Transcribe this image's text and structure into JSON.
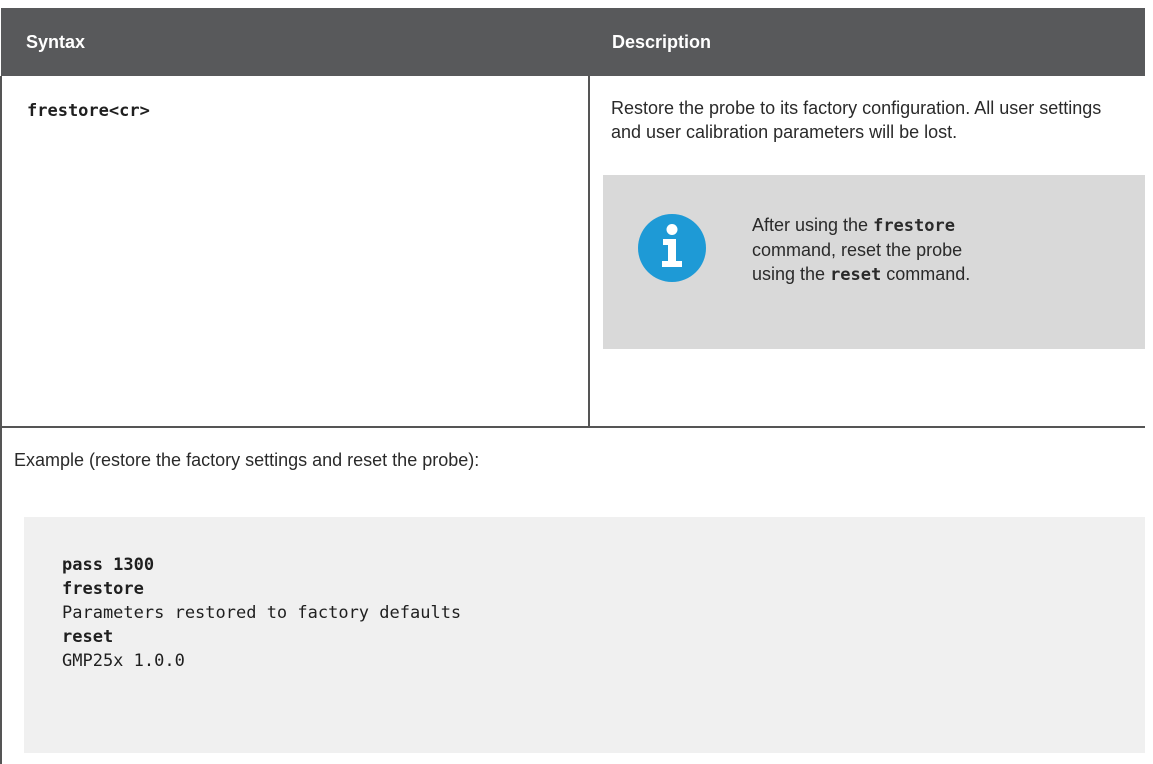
{
  "table": {
    "headers": {
      "syntax": "Syntax",
      "description": "Description"
    },
    "syntax": "frestore<cr>",
    "description": "Restore the probe to its factory configuration. All user settings and user calibration parameters will be lost.",
    "note": {
      "icon": "info-icon",
      "part1": "After using the ",
      "cmd1": "frestore",
      "part2": " command, reset the probe using the ",
      "cmd2": "reset",
      "part3": " command."
    },
    "example_label": "Example (restore the factory settings and reset the probe):"
  },
  "code": {
    "lines": [
      {
        "text": "pass 1300",
        "bold": true
      },
      {
        "text": "frestore",
        "bold": true
      },
      {
        "text": "Parameters restored to factory defaults",
        "bold": false
      },
      {
        "text": "reset",
        "bold": true
      },
      {
        "text": "GMP25x 1.0.0",
        "bold": false
      }
    ]
  },
  "colors": {
    "header_bg": "#58595b",
    "note_bg": "#d9d9d9",
    "code_bg": "#f0f0f0",
    "info_icon": "#1e9ad6"
  }
}
